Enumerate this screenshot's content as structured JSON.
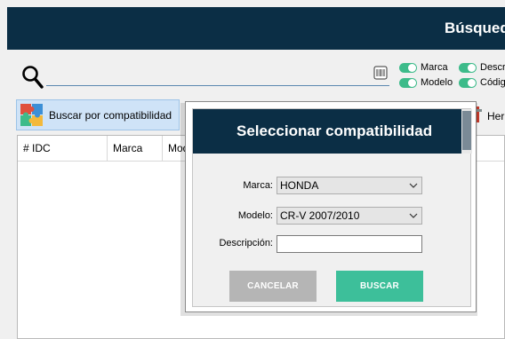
{
  "window": {
    "title": "Búsqued"
  },
  "search": {
    "value": "",
    "placeholder": ""
  },
  "filters": {
    "marca": "Marca",
    "modelo": "Modelo",
    "descripcion": "Descr",
    "codigo": "Código"
  },
  "toolbar": {
    "compat_label": "Buscar por compatibilidad",
    "tools_label": "Her"
  },
  "grid": {
    "columns": [
      "# IDC",
      "Marca",
      "Mod"
    ]
  },
  "dialog": {
    "title": "Seleccionar compatibilidad",
    "marca_label": "Marca:",
    "marca_value": "HONDA",
    "modelo_label": "Modelo:",
    "modelo_value": "CR-V 2007/2010",
    "descripcion_label": "Descripción:",
    "descripcion_value": "",
    "cancel_label": "CANCELAR",
    "search_label": "BUSCAR"
  },
  "colors": {
    "title_bar": "#0b2e45",
    "toggle_on": "#3dbb8a",
    "search_button": "#3dbf9a",
    "cancel_button": "#b5b5b5"
  },
  "icons": [
    "search-icon",
    "barcode-icon",
    "puzzle-icon",
    "tools-icon",
    "chevron-down-icon"
  ]
}
